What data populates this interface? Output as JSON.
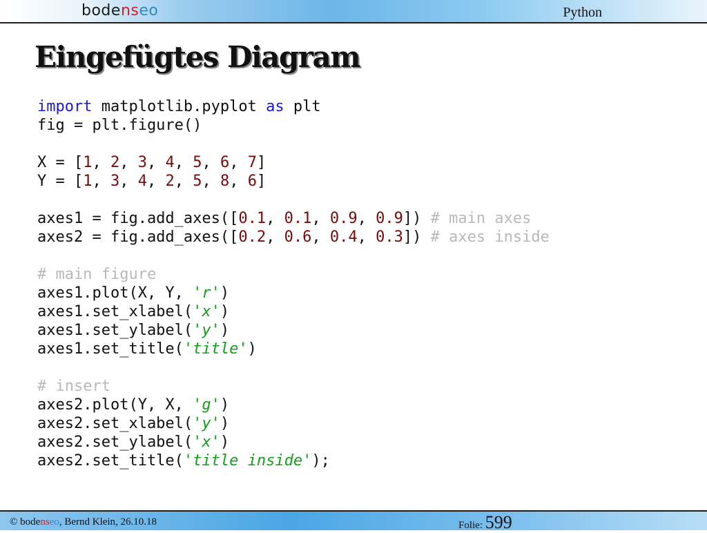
{
  "header": {
    "logo": {
      "part1": "bode",
      "part2": "n",
      "part3": "s",
      "part4": "e",
      "part5": "o"
    },
    "topic": "Python"
  },
  "slide": {
    "title": "Eingefügtes Diagram"
  },
  "code": {
    "l1": {
      "kw1": "import",
      "t1": " matplotlib.pyplot ",
      "kw2": "as",
      "t2": " plt"
    },
    "l2": "fig = plt.figure()",
    "l3": {
      "t0": "X = [",
      "n1": "1",
      "n2": "2",
      "n3": "3",
      "n4": "4",
      "n5": "5",
      "n6": "6",
      "n7": "7",
      "sep": ", ",
      "end": "]"
    },
    "l4": {
      "t0": "Y = [",
      "n1": "1",
      "n2": "3",
      "n3": "4",
      "n4": "2",
      "n5": "5",
      "n6": "8",
      "n7": "6",
      "sep": ", ",
      "end": "]"
    },
    "l5": {
      "t0": "axes1 = fig.add_axes([",
      "n1": "0.1",
      "n2": "0.1",
      "n3": "0.9",
      "n4": "0.9",
      "sep": ", ",
      "end": "]) ",
      "comment": "# main axes"
    },
    "l6": {
      "t0": "axes2 = fig.add_axes([",
      "n1": "0.2",
      "n2": "0.6",
      "n3": "0.4",
      "n4": "0.3",
      "sep": ", ",
      "end": "]) ",
      "comment": "# axes inside"
    },
    "l7": "# main figure",
    "l8": {
      "t0": "axes1.plot(X, Y, ",
      "s": "'r'",
      "t1": ")"
    },
    "l9": {
      "t0": "axes1.set_xlabel(",
      "s": "'x'",
      "t1": ")"
    },
    "l10": {
      "t0": "axes1.set_ylabel(",
      "s": "'y'",
      "t1": ")"
    },
    "l11": {
      "t0": "axes1.set_title(",
      "s": "'title'",
      "t1": ")"
    },
    "l12": "# insert",
    "l13": {
      "t0": "axes2.plot(Y, X, ",
      "s": "'g'",
      "t1": ")"
    },
    "l14": {
      "t0": "axes2.set_xlabel(",
      "s": "'y'",
      "t1": ")"
    },
    "l15": {
      "t0": "axes2.set_ylabel(",
      "s": "'x'",
      "t1": ")"
    },
    "l16": {
      "t0": "axes2.set_title(",
      "s": "'title inside'",
      "t1": ");"
    }
  },
  "footer": {
    "copy_prefix": "© bode",
    "copy_n": "n",
    "copy_s": "s",
    "copy_e": "e",
    "copy_o": "o",
    "copy_suffix": ", Bernd Klein, 26.10.18",
    "folio_label": "Folie: ",
    "folio_number": "599"
  },
  "colors": {
    "keyword": "#1a1adc",
    "number": "#7a0a0a",
    "string": "#12a01a",
    "comment": "#b9b9b9",
    "logo_red": "#d6202a",
    "logo_blue": "#2f89c9"
  }
}
